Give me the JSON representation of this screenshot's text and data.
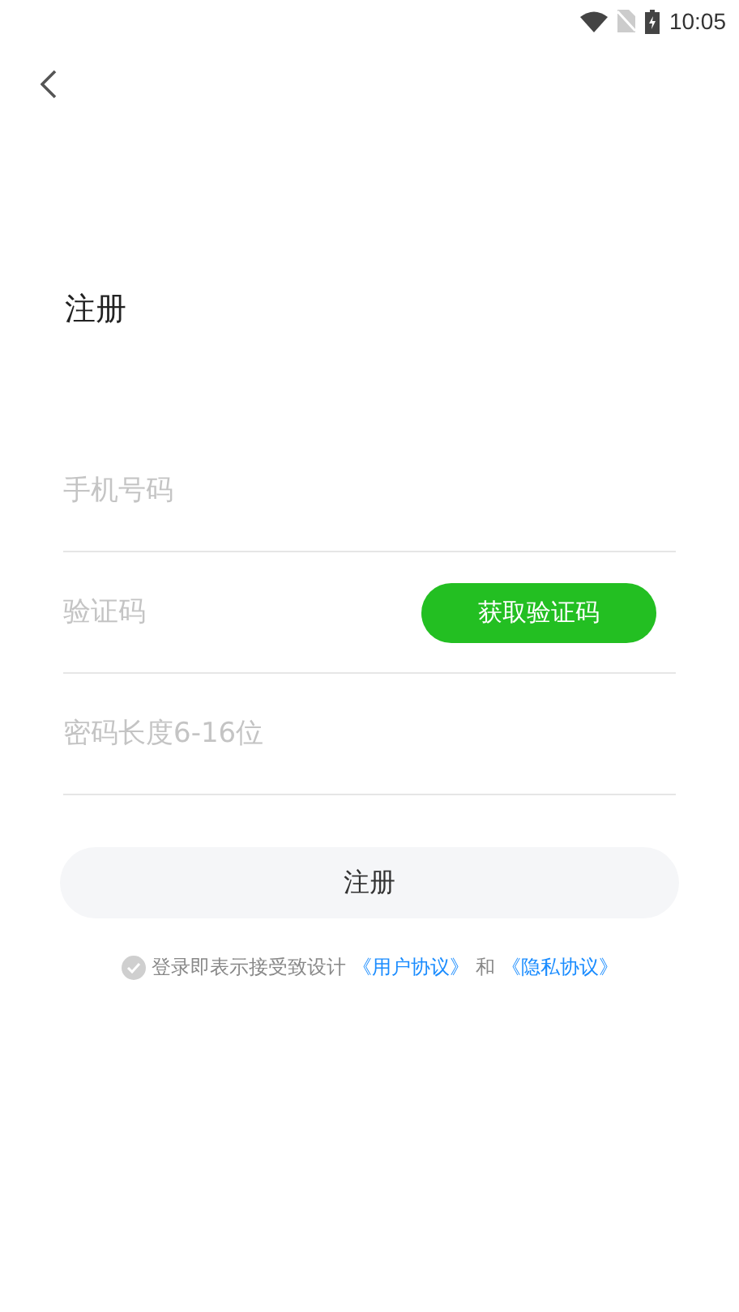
{
  "status_bar": {
    "time": "10:05"
  },
  "title": "注册",
  "fields": [
    {
      "placeholder": "手机号码",
      "kind": "text"
    },
    {
      "placeholder": "验证码",
      "kind": "code",
      "button": "获取验证码"
    },
    {
      "placeholder": "密码长度6-16位",
      "kind": "password"
    }
  ],
  "submit": "注册",
  "agreement": {
    "checked": false,
    "text": "登录即表示接受致设计",
    "link_1": "《用户协议》",
    "joiner": "和",
    "link_2": "《隐私协议》"
  }
}
